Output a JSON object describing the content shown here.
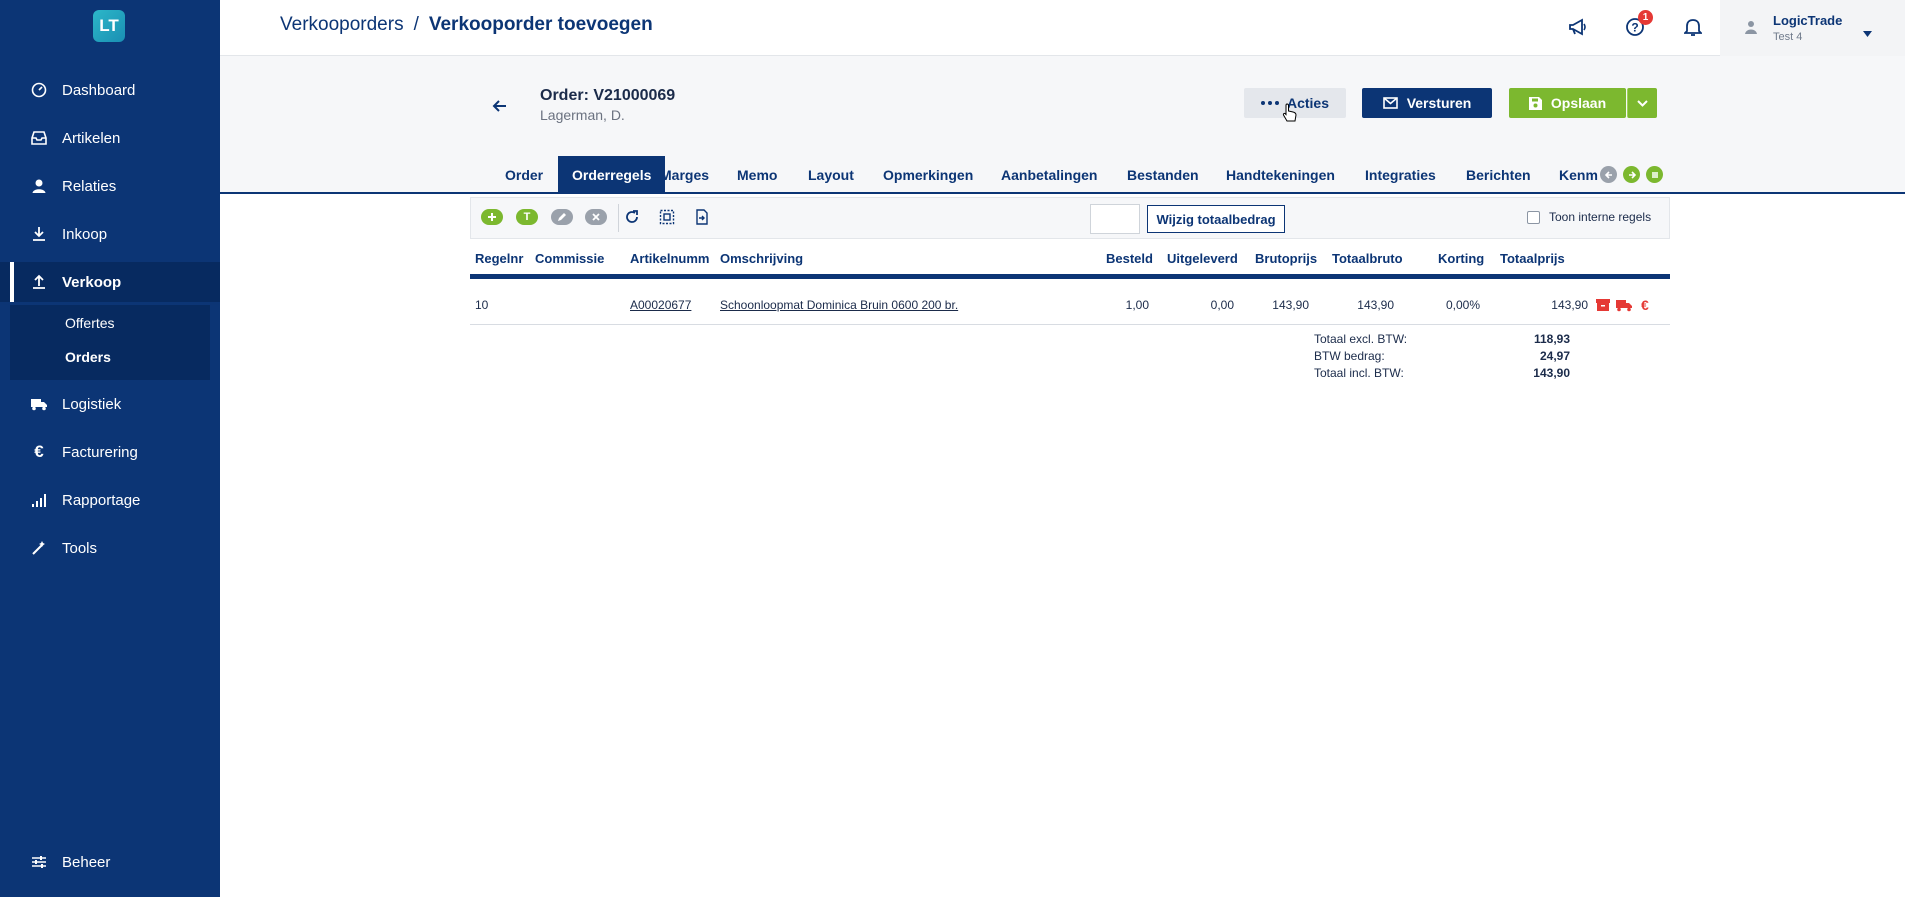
{
  "sidebar": {
    "logo": "LT",
    "items": [
      {
        "label": "Dashboard",
        "icon": "dashboard-icon"
      },
      {
        "label": "Artikelen",
        "icon": "inbox-icon"
      },
      {
        "label": "Relaties",
        "icon": "person-icon"
      },
      {
        "label": "Inkoop",
        "icon": "download-icon"
      },
      {
        "label": "Verkoop",
        "icon": "upload-icon"
      },
      {
        "label": "Logistiek",
        "icon": "truck-icon"
      },
      {
        "label": "Facturering",
        "icon": "euro-icon"
      },
      {
        "label": "Rapportage",
        "icon": "signal-icon"
      },
      {
        "label": "Tools",
        "icon": "wand-icon"
      },
      {
        "label": "Beheer",
        "icon": "sliders-icon"
      }
    ],
    "sub_items": [
      {
        "label": "Offertes"
      },
      {
        "label": "Orders"
      }
    ]
  },
  "topbar": {
    "breadcrumb_parent": "Verkooporders",
    "breadcrumb_separator": "/",
    "breadcrumb_current": "Verkooporder toevoegen",
    "help_badge": "1",
    "user_name": "LogicTrade",
    "user_sub": "Test 4"
  },
  "order": {
    "title": "Order: V21000069",
    "customer": "Lagerman, D."
  },
  "actions": {
    "acties": "Acties",
    "versturen": "Versturen",
    "opslaan": "Opslaan"
  },
  "tabs": [
    {
      "label": "Order"
    },
    {
      "label": "Orderregels"
    },
    {
      "label": "Marges"
    },
    {
      "label": "Memo"
    },
    {
      "label": "Layout"
    },
    {
      "label": "Opmerkingen"
    },
    {
      "label": "Aanbetalingen"
    },
    {
      "label": "Bestanden"
    },
    {
      "label": "Handtekeningen"
    },
    {
      "label": "Integraties"
    },
    {
      "label": "Berichten"
    },
    {
      "label": "Kenm"
    }
  ],
  "toolbar": {
    "wijzig_label": "Wijzig totaalbedrag",
    "amount_value": "",
    "toon_label": "Toon interne regels",
    "add_text_label": "T"
  },
  "table": {
    "headers": {
      "regelnr": "Regelnr",
      "commissie": "Commissie",
      "artikelnummer": "Artikelnumm",
      "omschrijving": "Omschrijving",
      "besteld": "Besteld",
      "uitgeleverd": "Uitgeleverd",
      "brutoprijs": "Brutoprijs",
      "totaalbruto": "Totaalbruto",
      "korting": "Korting",
      "totaalprijs": "Totaalprijs"
    },
    "rows": [
      {
        "regelnr": "10",
        "commissie": "",
        "artikelnummer": "A00020677",
        "omschrijving": "Schoonloopmat Dominica Bruin 0600 200 br.",
        "besteld": "1,00",
        "uitgeleverd": "0,00",
        "brutoprijs": "143,90",
        "totaalbruto": "143,90",
        "korting": "0,00%",
        "totaalprijs": "143,90"
      }
    ]
  },
  "totals": {
    "excl_label": "Totaal excl. BTW:",
    "excl_value": "118,93",
    "btw_label": "BTW bedrag:",
    "btw_value": "24,97",
    "incl_label": "Totaal incl. BTW:",
    "incl_value": "143,90"
  },
  "colors": {
    "primary": "#0c3575",
    "accent_green": "#7cb82f",
    "danger": "#e53935"
  }
}
